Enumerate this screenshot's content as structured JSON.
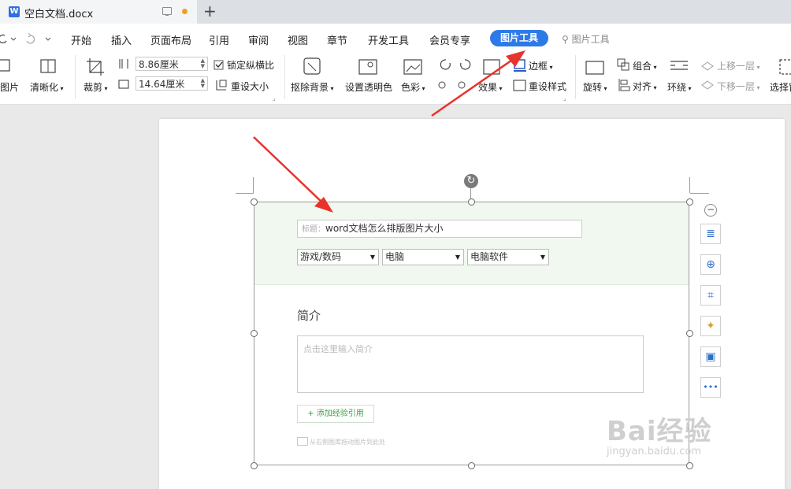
{
  "title_bar": {
    "doc_icon": "W",
    "doc_name": "空白文档.docx",
    "new_tab": "+",
    "pin_icon": "display-icon",
    "unsaved_dot_color": "#f0a020"
  },
  "menu": {
    "items": [
      "开始",
      "插入",
      "页面布局",
      "引用",
      "审阅",
      "视图",
      "章节",
      "开发工具",
      "会员专享"
    ],
    "active": "图片工具",
    "search_label": "图片工具",
    "undo_icon": "undo-icon",
    "redo_icon": "redo-icon"
  },
  "ribbon": {
    "to_image": "图片",
    "sharpen": "清晰化",
    "crop": "裁剪",
    "width_value": "8.86厘米",
    "height_value": "14.64厘米",
    "lock_ratio": "锁定纵横比",
    "reset_size": "重设大小",
    "remove_bg": "抠除背景",
    "set_transparent": "设置透明色",
    "color": "色彩",
    "effects": "效果",
    "border": "边框",
    "reset_style": "重设样式",
    "rotate": "旋转",
    "group": "组合",
    "align": "对齐",
    "wrap": "环绕",
    "bring_forward": "上移一层",
    "send_backward": "下移一层",
    "select_pane": "选择窗"
  },
  "form": {
    "title_label": "标题：",
    "title_value": "word文档怎么排版图片大小",
    "category1": "游戏/数码",
    "category2": "电脑",
    "category3": "电脑软件",
    "intro_heading": "简介",
    "intro_placeholder": "点击这里输入简介",
    "add_reference": "+ 添加经验引用",
    "drag_hint": "从右侧图库拖动图片到此处"
  },
  "side_tools": [
    "collapse-icon",
    "layout-options-icon",
    "zoom-icon",
    "crop-icon",
    "idea-icon",
    "image-to-text-icon",
    "more-icon"
  ],
  "watermark": {
    "brand": "Bai经验",
    "url": "jingyan.baidu.com"
  },
  "colors": {
    "accent": "#2e79e8",
    "annotation_arrow": "#e8322c",
    "green_band": "#f0f8ef"
  }
}
